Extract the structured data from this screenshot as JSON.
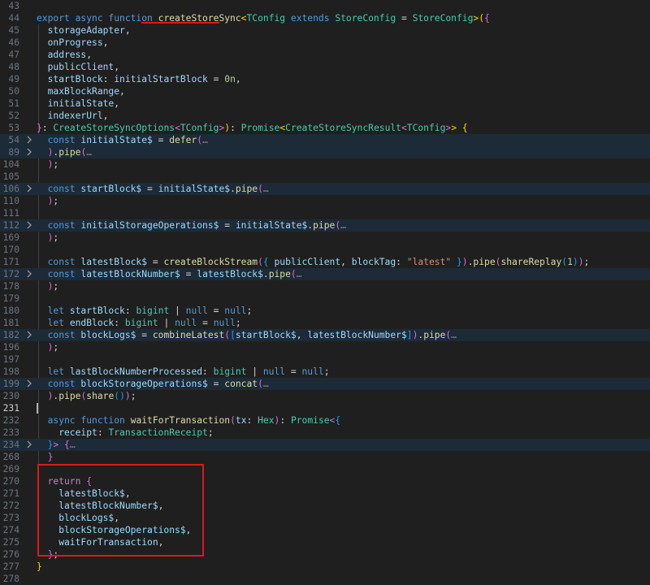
{
  "editor": {
    "lines": [
      {
        "num": "43",
        "tokens": []
      },
      {
        "num": "44",
        "tokens": [
          [
            "export ",
            "kw"
          ],
          [
            "async ",
            "kw"
          ],
          [
            "function ",
            "kw"
          ],
          [
            "createStoreSync",
            "fn"
          ],
          [
            "<",
            "b1"
          ],
          [
            "TConfig ",
            "type"
          ],
          [
            "extends ",
            "kw"
          ],
          [
            "StoreConfig",
            "type"
          ],
          [
            " = ",
            "txt"
          ],
          [
            "StoreConfig",
            "type"
          ],
          [
            ">",
            "b1"
          ],
          [
            "(",
            "b1"
          ],
          [
            "{",
            "b2"
          ]
        ]
      },
      {
        "num": "45",
        "tokens": [
          [
            "  storageAdapter",
            "var"
          ],
          [
            ",",
            "txt"
          ]
        ]
      },
      {
        "num": "46",
        "tokens": [
          [
            "  onProgress",
            "var"
          ],
          [
            ",",
            "txt"
          ]
        ]
      },
      {
        "num": "47",
        "tokens": [
          [
            "  address",
            "var"
          ],
          [
            ",",
            "txt"
          ]
        ]
      },
      {
        "num": "48",
        "tokens": [
          [
            "  publicClient",
            "var"
          ],
          [
            ",",
            "txt"
          ]
        ]
      },
      {
        "num": "49",
        "tokens": [
          [
            "  startBlock",
            "var"
          ],
          [
            ": ",
            "txt"
          ],
          [
            "initialStartBlock",
            "var"
          ],
          [
            " = ",
            "txt"
          ],
          [
            "0n",
            "num"
          ],
          [
            ",",
            "txt"
          ]
        ]
      },
      {
        "num": "50",
        "tokens": [
          [
            "  maxBlockRange",
            "var"
          ],
          [
            ",",
            "txt"
          ]
        ]
      },
      {
        "num": "51",
        "tokens": [
          [
            "  initialState",
            "var"
          ],
          [
            ",",
            "txt"
          ]
        ]
      },
      {
        "num": "52",
        "tokens": [
          [
            "  indexerUrl",
            "var"
          ],
          [
            ",",
            "txt"
          ]
        ]
      },
      {
        "num": "53",
        "tokens": [
          [
            "}",
            "b2"
          ],
          [
            ": ",
            "txt"
          ],
          [
            "CreateStoreSyncOptions",
            "type"
          ],
          [
            "<",
            "b2"
          ],
          [
            "TConfig",
            "type"
          ],
          [
            ">",
            "b2"
          ],
          [
            ")",
            "b1"
          ],
          [
            ": ",
            "txt"
          ],
          [
            "Promise",
            "type"
          ],
          [
            "<",
            "b1"
          ],
          [
            "CreateStoreSyncResult",
            "type"
          ],
          [
            "<",
            "b2"
          ],
          [
            "TConfig",
            "type"
          ],
          [
            ">",
            "b2"
          ],
          [
            ">",
            "b1"
          ],
          [
            " ",
            "txt"
          ],
          [
            "{",
            "b1"
          ]
        ]
      },
      {
        "num": "54",
        "fold": true,
        "tokens": [
          [
            "  const ",
            "kw"
          ],
          [
            "initialState$",
            "var"
          ],
          [
            " = ",
            "txt"
          ],
          [
            "defer",
            "fn"
          ],
          [
            "(",
            "b2"
          ],
          [
            "…",
            "ell"
          ]
        ]
      },
      {
        "num": "89",
        "fold": true,
        "tokens": [
          [
            "  ",
            "txt"
          ],
          [
            ")",
            "b2"
          ],
          [
            ".",
            "txt"
          ],
          [
            "pipe",
            "fn"
          ],
          [
            "(",
            "b2"
          ],
          [
            "…",
            "ell"
          ]
        ]
      },
      {
        "num": "104",
        "tokens": [
          [
            "  ",
            "txt"
          ],
          [
            ")",
            "b2"
          ],
          [
            ";",
            "txt"
          ]
        ]
      },
      {
        "num": "105",
        "tokens": []
      },
      {
        "num": "106",
        "fold": true,
        "tokens": [
          [
            "  const ",
            "kw"
          ],
          [
            "startBlock$",
            "var"
          ],
          [
            " = ",
            "txt"
          ],
          [
            "initialState$",
            "var"
          ],
          [
            ".",
            "txt"
          ],
          [
            "pipe",
            "fn"
          ],
          [
            "(",
            "b2"
          ],
          [
            "…",
            "ell"
          ]
        ]
      },
      {
        "num": "110",
        "tokens": [
          [
            "  ",
            "txt"
          ],
          [
            ")",
            "b2"
          ],
          [
            ";",
            "txt"
          ]
        ]
      },
      {
        "num": "111",
        "tokens": []
      },
      {
        "num": "112",
        "fold": true,
        "tokens": [
          [
            "  const ",
            "kw"
          ],
          [
            "initialStorageOperations$",
            "var"
          ],
          [
            " = ",
            "txt"
          ],
          [
            "initialState$",
            "var"
          ],
          [
            ".",
            "txt"
          ],
          [
            "pipe",
            "fn"
          ],
          [
            "(",
            "b2"
          ],
          [
            "…",
            "ell"
          ]
        ]
      },
      {
        "num": "169",
        "tokens": [
          [
            "  ",
            "txt"
          ],
          [
            ")",
            "b2"
          ],
          [
            ";",
            "txt"
          ]
        ]
      },
      {
        "num": "170",
        "tokens": []
      },
      {
        "num": "171",
        "tokens": [
          [
            "  const ",
            "kw"
          ],
          [
            "latestBlock$",
            "var"
          ],
          [
            " = ",
            "txt"
          ],
          [
            "createBlockStream",
            "fn"
          ],
          [
            "(",
            "b2"
          ],
          [
            "{ ",
            "b3"
          ],
          [
            "publicClient",
            "var"
          ],
          [
            ", ",
            "txt"
          ],
          [
            "blockTag",
            "var"
          ],
          [
            ": ",
            "txt"
          ],
          [
            "\"latest\"",
            "str"
          ],
          [
            " }",
            "b3"
          ],
          [
            ")",
            "b2"
          ],
          [
            ".",
            "txt"
          ],
          [
            "pipe",
            "fn"
          ],
          [
            "(",
            "b2"
          ],
          [
            "shareReplay",
            "fn"
          ],
          [
            "(",
            "b3"
          ],
          [
            "1",
            "num"
          ],
          [
            ")",
            "b3"
          ],
          [
            ")",
            "b2"
          ],
          [
            ";",
            "txt"
          ]
        ]
      },
      {
        "num": "172",
        "fold": true,
        "tokens": [
          [
            "  const ",
            "kw"
          ],
          [
            "latestBlockNumber$",
            "var"
          ],
          [
            " = ",
            "txt"
          ],
          [
            "latestBlock$",
            "var"
          ],
          [
            ".",
            "txt"
          ],
          [
            "pipe",
            "fn"
          ],
          [
            "(",
            "b2"
          ],
          [
            "…",
            "ell"
          ]
        ]
      },
      {
        "num": "178",
        "tokens": [
          [
            "  ",
            "txt"
          ],
          [
            ")",
            "b2"
          ],
          [
            ";",
            "txt"
          ]
        ]
      },
      {
        "num": "179",
        "tokens": []
      },
      {
        "num": "180",
        "tokens": [
          [
            "  let ",
            "kw"
          ],
          [
            "startBlock",
            "var"
          ],
          [
            ": ",
            "txt"
          ],
          [
            "bigint",
            "type"
          ],
          [
            " | ",
            "txt"
          ],
          [
            "null",
            "kw"
          ],
          [
            " = ",
            "txt"
          ],
          [
            "null",
            "kw"
          ],
          [
            ";",
            "txt"
          ]
        ]
      },
      {
        "num": "181",
        "tokens": [
          [
            "  let ",
            "kw"
          ],
          [
            "endBlock",
            "var"
          ],
          [
            ": ",
            "txt"
          ],
          [
            "bigint",
            "type"
          ],
          [
            " | ",
            "txt"
          ],
          [
            "null",
            "kw"
          ],
          [
            " = ",
            "txt"
          ],
          [
            "null",
            "kw"
          ],
          [
            ";",
            "txt"
          ]
        ]
      },
      {
        "num": "182",
        "fold": true,
        "tokens": [
          [
            "  const ",
            "kw"
          ],
          [
            "blockLogs$",
            "var"
          ],
          [
            " = ",
            "txt"
          ],
          [
            "combineLatest",
            "fn"
          ],
          [
            "(",
            "b2"
          ],
          [
            "[",
            "b3"
          ],
          [
            "startBlock$",
            "var"
          ],
          [
            ", ",
            "txt"
          ],
          [
            "latestBlockNumber$",
            "var"
          ],
          [
            "]",
            "b3"
          ],
          [
            ")",
            "b2"
          ],
          [
            ".",
            "txt"
          ],
          [
            "pipe",
            "fn"
          ],
          [
            "(",
            "b2"
          ],
          [
            "…",
            "ell"
          ]
        ]
      },
      {
        "num": "196",
        "tokens": [
          [
            "  ",
            "txt"
          ],
          [
            ")",
            "b2"
          ],
          [
            ";",
            "txt"
          ]
        ]
      },
      {
        "num": "197",
        "tokens": []
      },
      {
        "num": "198",
        "tokens": [
          [
            "  let ",
            "kw"
          ],
          [
            "lastBlockNumberProcessed",
            "var"
          ],
          [
            ": ",
            "txt"
          ],
          [
            "bigint",
            "type"
          ],
          [
            " | ",
            "txt"
          ],
          [
            "null",
            "kw"
          ],
          [
            " = ",
            "txt"
          ],
          [
            "null",
            "kw"
          ],
          [
            ";",
            "txt"
          ]
        ]
      },
      {
        "num": "199",
        "fold": true,
        "tokens": [
          [
            "  const ",
            "kw"
          ],
          [
            "blockStorageOperations$",
            "var"
          ],
          [
            " = ",
            "txt"
          ],
          [
            "concat",
            "fn"
          ],
          [
            "(",
            "b2"
          ],
          [
            "…",
            "ell"
          ]
        ]
      },
      {
        "num": "230",
        "tokens": [
          [
            "  ",
            "txt"
          ],
          [
            ")",
            "b2"
          ],
          [
            ".",
            "txt"
          ],
          [
            "pipe",
            "fn"
          ],
          [
            "(",
            "b2"
          ],
          [
            "share",
            "fn"
          ],
          [
            "()",
            "b3"
          ],
          [
            ")",
            "b2"
          ],
          [
            ";",
            "txt"
          ]
        ]
      },
      {
        "num": "231",
        "current": true,
        "tokens": []
      },
      {
        "num": "232",
        "tokens": [
          [
            "  async ",
            "kw"
          ],
          [
            "function ",
            "kw"
          ],
          [
            "waitForTransaction",
            "fn"
          ],
          [
            "(",
            "b2"
          ],
          [
            "tx",
            "var"
          ],
          [
            ": ",
            "txt"
          ],
          [
            "Hex",
            "type"
          ],
          [
            ")",
            "b2"
          ],
          [
            ": ",
            "txt"
          ],
          [
            "Promise",
            "type"
          ],
          [
            "<",
            "b2"
          ],
          [
            "{",
            "b3"
          ]
        ]
      },
      {
        "num": "233",
        "tokens": [
          [
            "    receipt",
            "var"
          ],
          [
            ": ",
            "txt"
          ],
          [
            "TransactionReceipt",
            "type"
          ],
          [
            ";",
            "txt"
          ]
        ]
      },
      {
        "num": "234",
        "fold": true,
        "tokens": [
          [
            "  ",
            "txt"
          ],
          [
            "}",
            "b3"
          ],
          [
            ">",
            "b2"
          ],
          [
            " ",
            "txt"
          ],
          [
            "{",
            "b2"
          ],
          [
            "…",
            "ell"
          ]
        ]
      },
      {
        "num": "268",
        "tokens": [
          [
            "  ",
            "txt"
          ],
          [
            "}",
            "b2"
          ]
        ]
      },
      {
        "num": "269",
        "tokens": []
      },
      {
        "num": "270",
        "tokens": [
          [
            "  return ",
            "kwc"
          ],
          [
            "{",
            "b2"
          ]
        ]
      },
      {
        "num": "271",
        "tokens": [
          [
            "    latestBlock$",
            "var"
          ],
          [
            ",",
            "txt"
          ]
        ]
      },
      {
        "num": "272",
        "tokens": [
          [
            "    latestBlockNumber$",
            "var"
          ],
          [
            ",",
            "txt"
          ]
        ]
      },
      {
        "num": "273",
        "tokens": [
          [
            "    blockLogs$",
            "var"
          ],
          [
            ",",
            "txt"
          ]
        ]
      },
      {
        "num": "274",
        "tokens": [
          [
            "    blockStorageOperations$",
            "var"
          ],
          [
            ",",
            "txt"
          ]
        ]
      },
      {
        "num": "275",
        "tokens": [
          [
            "    waitForTransaction",
            "var"
          ],
          [
            ",",
            "txt"
          ]
        ]
      },
      {
        "num": "276",
        "tokens": [
          [
            "  ",
            "txt"
          ],
          [
            "}",
            "b2"
          ],
          [
            ";",
            "txt"
          ]
        ]
      },
      {
        "num": "277",
        "tokens": [
          [
            "}",
            "b1"
          ]
        ]
      },
      {
        "num": "278",
        "tokens": []
      }
    ]
  },
  "annotations": {
    "underline_target": "createStoreSync",
    "box_target": "return block"
  },
  "colors": {
    "background": "#1f1f1f",
    "folded_line": "#1d2a37",
    "annotation": "#e0161e",
    "keyword": "#569cd6",
    "function": "#dcdcaa",
    "type": "#4ec9b0",
    "variable": "#9cdcfe"
  },
  "icons": {
    "fold_collapsed": "chevron-right-icon"
  }
}
